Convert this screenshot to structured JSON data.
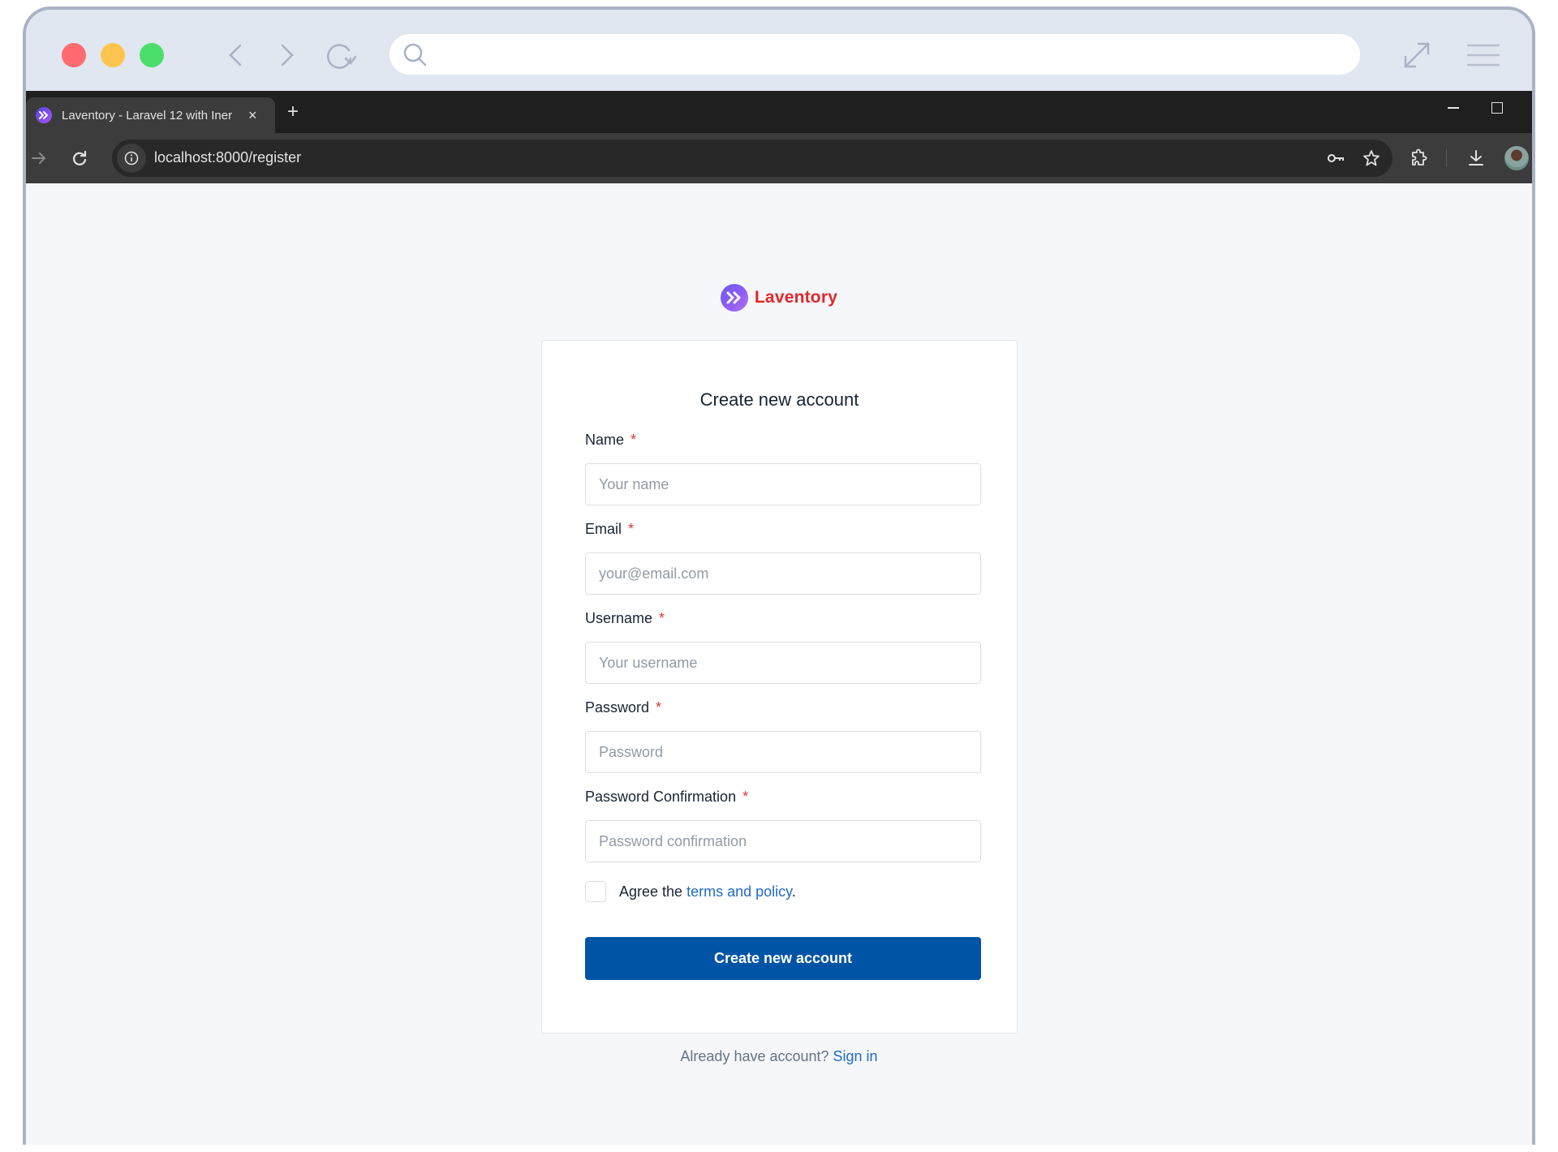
{
  "browser": {
    "tab_title": "Laventory - Laravel 12 with Iner",
    "new_tab_label": "+",
    "tab_close_label": "×",
    "url": "localhost:8000/register"
  },
  "brand": {
    "name": "Laventory",
    "color": "#e5262b"
  },
  "form": {
    "title": "Create new account",
    "required_mark": "*",
    "fields": [
      {
        "label": "Name",
        "placeholder": "Your name",
        "value": ""
      },
      {
        "label": "Email",
        "placeholder": "your@email.com",
        "value": ""
      },
      {
        "label": "Username",
        "placeholder": "Your username",
        "value": ""
      },
      {
        "label": "Password",
        "placeholder": "Password",
        "value": ""
      },
      {
        "label": "Password Confirmation",
        "placeholder": "Password confirmation",
        "value": ""
      }
    ],
    "agree": {
      "checked": false,
      "prefix": "Agree the ",
      "link_text": "terms and policy",
      "suffix": "."
    },
    "submit_label": "Create new account",
    "submit_color": "#0054a6"
  },
  "footer": {
    "prompt": "Already have account? ",
    "link_text": "Sign in"
  },
  "icons": {
    "mac_back": "chevron-left-icon",
    "mac_forward": "chevron-right-icon",
    "mac_reload": "reload-icon",
    "mac_search": "search-icon",
    "mac_expand": "expand-icon",
    "mac_menu": "hamburger-menu-icon",
    "chrome_forward": "arrow-right-icon",
    "chrome_reload": "reload-icon",
    "site_info": "info-icon",
    "password_key": "key-icon",
    "bookmark": "star-icon",
    "extensions": "puzzle-icon",
    "downloads": "download-icon",
    "profile": "avatar"
  }
}
